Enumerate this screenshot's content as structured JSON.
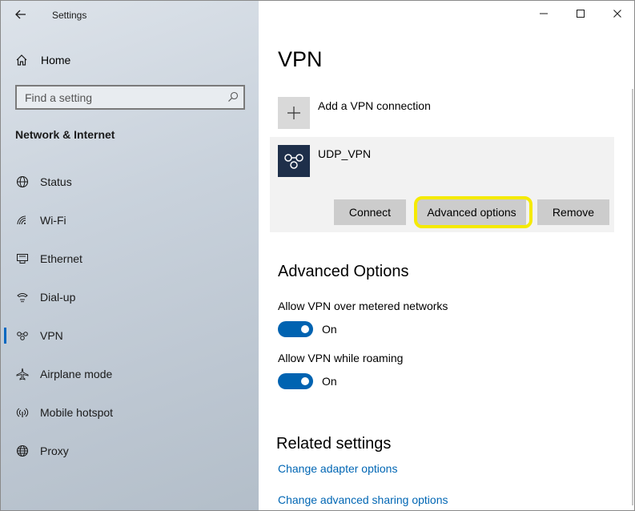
{
  "window": {
    "app_title": "Settings",
    "controls": [
      "minimize",
      "maximize",
      "close"
    ]
  },
  "sidebar": {
    "home_label": "Home",
    "search": {
      "placeholder": "Find a setting"
    },
    "section_title": "Network & Internet",
    "items": [
      {
        "label": "Status",
        "icon": "globe-status-icon",
        "active": false
      },
      {
        "label": "Wi-Fi",
        "icon": "wifi-icon",
        "active": false
      },
      {
        "label": "Ethernet",
        "icon": "ethernet-icon",
        "active": false
      },
      {
        "label": "Dial-up",
        "icon": "dialup-icon",
        "active": false
      },
      {
        "label": "VPN",
        "icon": "vpn-icon",
        "active": true
      },
      {
        "label": "Airplane mode",
        "icon": "airplane-icon",
        "active": false
      },
      {
        "label": "Mobile hotspot",
        "icon": "hotspot-icon",
        "active": false
      },
      {
        "label": "Proxy",
        "icon": "globe-icon",
        "active": false
      }
    ]
  },
  "main": {
    "title": "VPN",
    "add_vpn_label": "Add a VPN connection",
    "connection": {
      "name": "UDP_VPN",
      "buttons": {
        "connect": "Connect",
        "advanced": "Advanced options",
        "remove": "Remove"
      }
    },
    "advanced": {
      "title": "Advanced Options",
      "toggles": [
        {
          "label": "Allow VPN over metered networks",
          "state": "On"
        },
        {
          "label": "Allow VPN while roaming",
          "state": "On"
        }
      ]
    },
    "related": {
      "title": "Related settings",
      "links": [
        "Change adapter options",
        "Change advanced sharing options"
      ]
    }
  },
  "colors": {
    "accent": "#0063b1",
    "link": "#0066b4",
    "highlight": "#f5ea00",
    "vpn_logo_bg": "#1e2f4a"
  }
}
